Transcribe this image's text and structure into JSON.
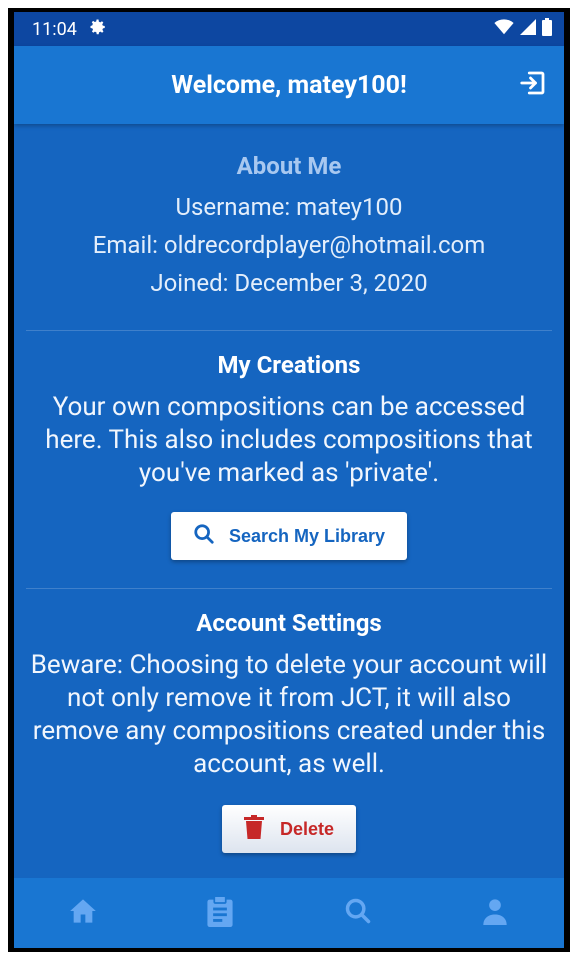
{
  "status_bar": {
    "time": "11:04"
  },
  "app_bar": {
    "title": "Welcome, matey100!"
  },
  "about": {
    "heading": "About Me",
    "username": "Username: matey100",
    "email": "Email: oldrecordplayer@hotmail.com",
    "joined": "Joined: December 3, 2020"
  },
  "creations": {
    "heading": "My Creations",
    "description": "Your own compositions can be accessed here. This also includes compositions that you've marked as 'private'.",
    "button_label": "Search My Library"
  },
  "settings": {
    "heading": "Account Settings",
    "description": "Beware: Choosing to delete your account will not only remove it from JCT, it will also remove any compositions created under this account, as well.",
    "delete_label": "Delete"
  },
  "nav": {
    "items": [
      "home-icon",
      "clipboard-icon",
      "search-icon",
      "person-icon"
    ]
  },
  "colors": {
    "background": "#1565c0",
    "app_bar": "#1976d2",
    "danger": "#c62828"
  }
}
